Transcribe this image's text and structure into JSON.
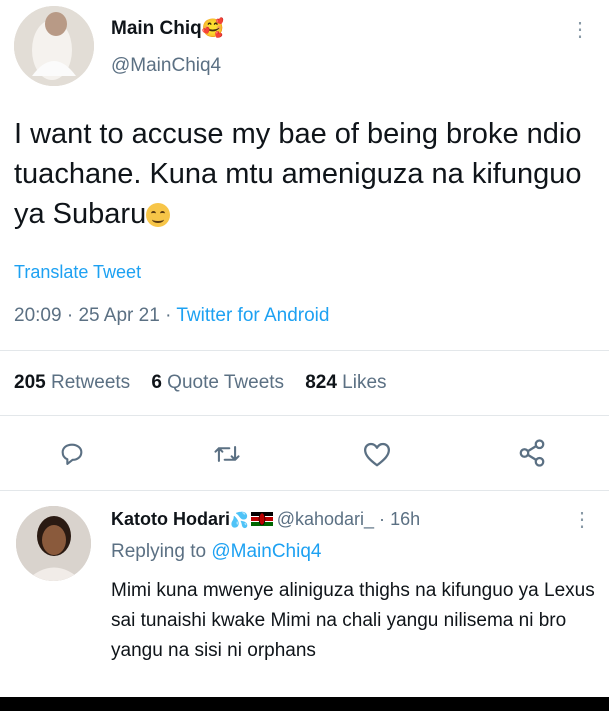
{
  "tweet": {
    "author_name": "Main Chiq",
    "author_emoji": "🥰",
    "handle": "@MainChiq4",
    "text": "I want to accuse my bae of being broke ndio tuachane. Kuna mtu ameniguza na kifunguo ya Subaru",
    "text_emoji": "😊",
    "translate": "Translate Tweet",
    "time": "20:09",
    "date": "25 Apr 21",
    "source": "Twitter for Android",
    "sep": "·",
    "stats": [
      {
        "count": "205",
        "label": "Retweets"
      },
      {
        "count": "6",
        "label": "Quote Tweets"
      },
      {
        "count": "824",
        "label": "Likes"
      }
    ],
    "actions": [
      "reply-icon",
      "retweet-icon",
      "like-icon",
      "share-icon"
    ],
    "menu_glyph": "⋮"
  },
  "reply": {
    "author_name": "Katoto Hodari",
    "author_emoji": "💦",
    "flag": "Kenya flag",
    "handle": "@kahodari_",
    "sep": "·",
    "age": "16h",
    "replying_prefix": "Replying to",
    "replying_handle": "@MainChiq4",
    "text": "Mimi kuna mwenye aliniguza thighs na kifunguo ya Lexus sai tunaishi kwake Mimi na chali yangu nilisema ni bro yangu na sisi ni orphans",
    "menu_glyph": "⋮"
  },
  "colors": {
    "accent": "#1da1f2",
    "muted": "#5b7083",
    "text": "#0f1419",
    "divider": "#e3e7ea"
  }
}
